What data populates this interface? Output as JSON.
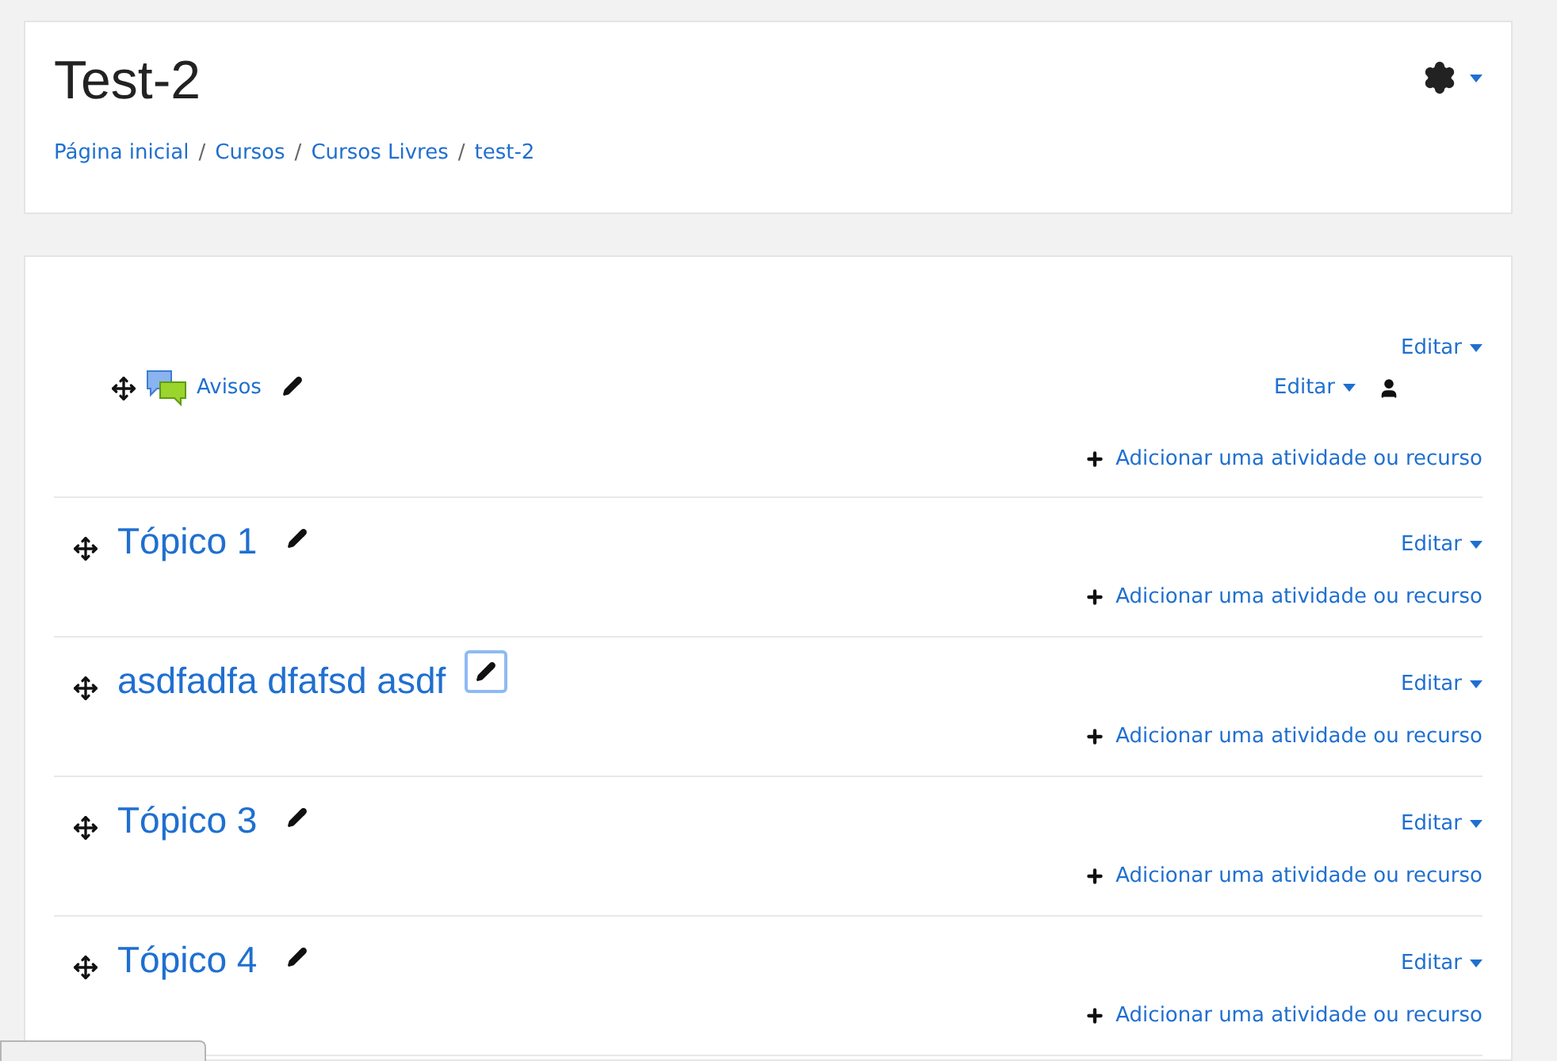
{
  "header": {
    "title": "Test-2",
    "separator": "/",
    "breadcrumbs": [
      "Página inicial",
      "Cursos",
      "Cursos Livres",
      "test-2"
    ]
  },
  "sections": [
    {
      "kind": "general",
      "edit": "Editar",
      "add": "Adicionar uma atividade ou recurso",
      "activities": [
        {
          "name": "Avisos",
          "edit": "Editar"
        }
      ]
    },
    {
      "kind": "topic",
      "title": "Tópico 1",
      "focused": false,
      "edit": "Editar",
      "add": "Adicionar uma atividade ou recurso"
    },
    {
      "kind": "topic",
      "title": "asdfadfa dfafsd asdf",
      "focused": true,
      "edit": "Editar",
      "add": "Adicionar uma atividade ou recurso"
    },
    {
      "kind": "topic",
      "title": "Tópico 3",
      "focused": false,
      "edit": "Editar",
      "add": "Adicionar uma atividade ou recurso"
    },
    {
      "kind": "topic",
      "title": "Tópico 4",
      "focused": false,
      "edit": "Editar",
      "add": "Adicionar uma atividade ou recurso"
    }
  ]
}
